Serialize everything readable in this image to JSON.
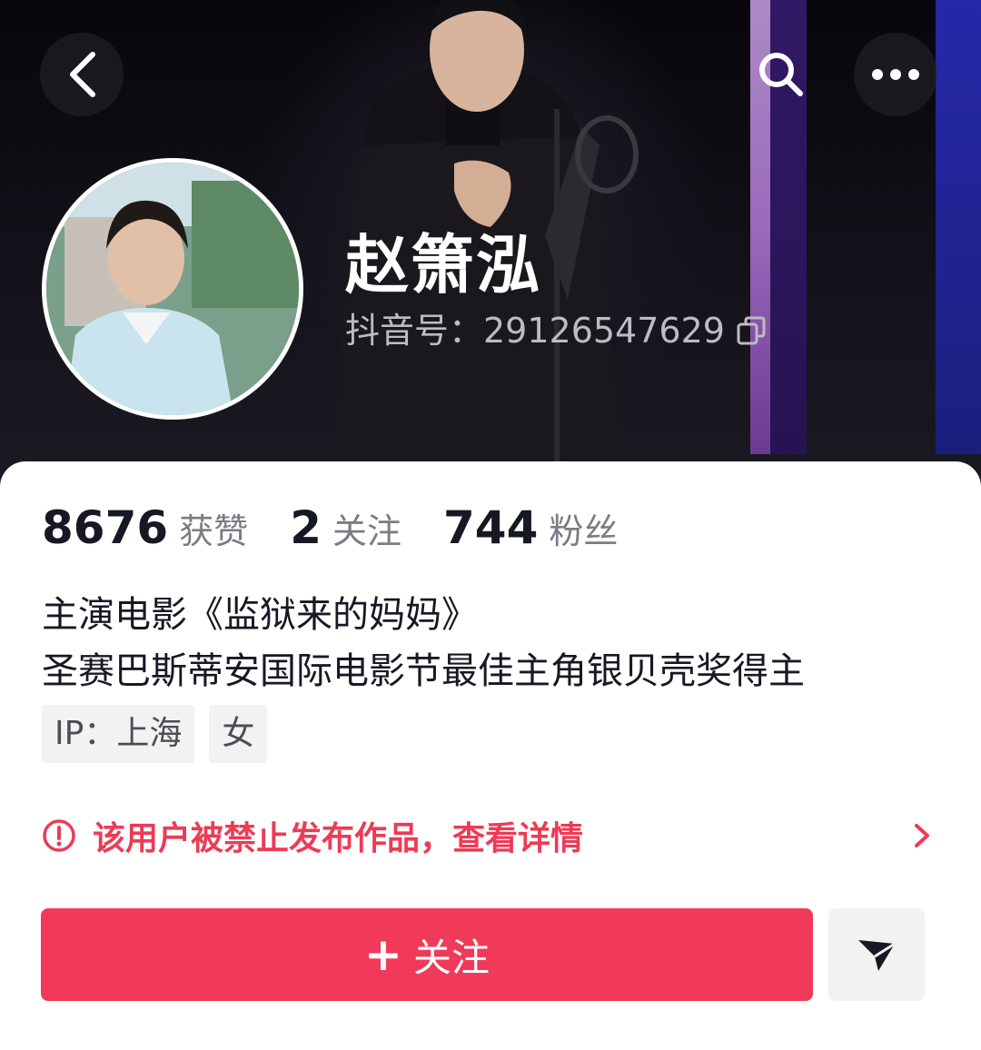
{
  "header": {
    "back_icon": "back-arrow-icon",
    "search_icon": "search-icon",
    "more_icon": "more-dots-icon"
  },
  "profile": {
    "name": "赵箫泓",
    "douyin_id": "抖音号：29126547629",
    "copy_icon": "copy-icon"
  },
  "stats": [
    {
      "value": "8676",
      "label": "获赞"
    },
    {
      "value": "2",
      "label": "关注"
    },
    {
      "value": "744",
      "label": "粉丝"
    }
  ],
  "bio": {
    "line1": "主演电影《监狱来的妈妈》",
    "line2": "圣赛巴斯蒂安国际电影节最佳主角银贝壳奖得主"
  },
  "tags": [
    "IP：上海",
    "女"
  ],
  "notice": {
    "text": "该用户被禁止发布作品，查看详情",
    "icon": "alert-circle-icon",
    "color": "#ec3b56"
  },
  "actions": {
    "follow_plus": "+",
    "follow_label": "关注",
    "follow_color": "#f1395a",
    "share_icon": "send-icon"
  }
}
